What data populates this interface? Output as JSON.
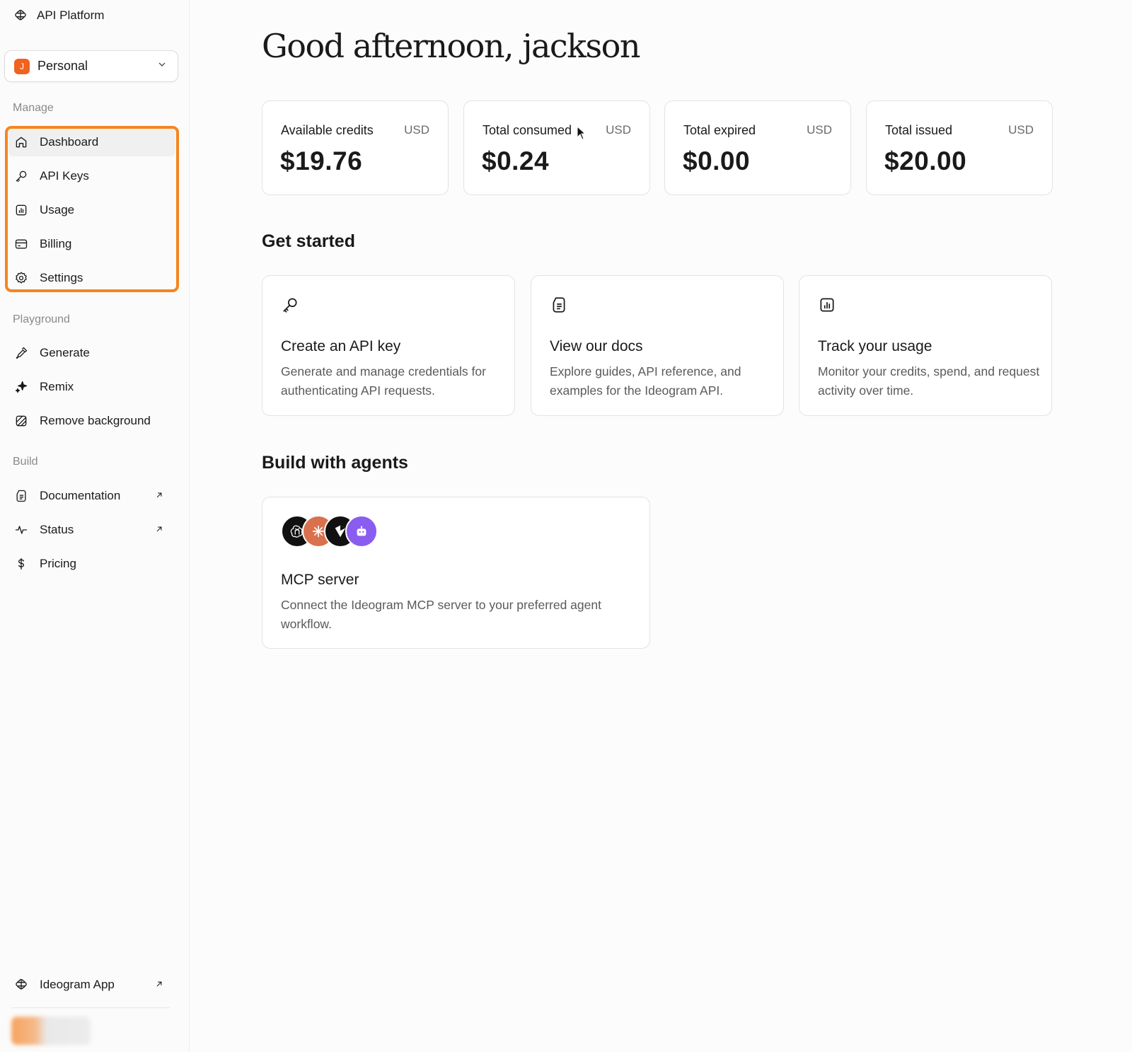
{
  "brand": {
    "name": "API Platform"
  },
  "workspace": {
    "initial": "J",
    "name": "Personal"
  },
  "sidebar": {
    "manage_label": "Manage",
    "manage": [
      {
        "label": "Dashboard",
        "icon": "home-icon"
      },
      {
        "label": "API Keys",
        "icon": "key-icon"
      },
      {
        "label": "Usage",
        "icon": "chart-icon"
      },
      {
        "label": "Billing",
        "icon": "card-icon"
      },
      {
        "label": "Settings",
        "icon": "gear-icon"
      }
    ],
    "playground_label": "Playground",
    "playground": [
      {
        "label": "Generate",
        "icon": "pen-icon"
      },
      {
        "label": "Remix",
        "icon": "sparkle-icon"
      },
      {
        "label": "Remove background",
        "icon": "slash-square-icon"
      }
    ],
    "build_label": "Build",
    "build": [
      {
        "label": "Documentation",
        "icon": "doc-icon",
        "external": true
      },
      {
        "label": "Status",
        "icon": "pulse-icon",
        "external": true
      },
      {
        "label": "Pricing",
        "icon": "dollar-icon"
      }
    ],
    "footer": {
      "label": "Ideogram App",
      "icon": "ideogram-logo-icon",
      "external": true
    }
  },
  "main": {
    "greeting": "Good afternoon, jackson",
    "stats": [
      {
        "label": "Available credits",
        "unit": "USD",
        "value": "$19.76"
      },
      {
        "label": "Total consumed",
        "unit": "USD",
        "value": "$0.24"
      },
      {
        "label": "Total expired",
        "unit": "USD",
        "value": "$0.00"
      },
      {
        "label": "Total issued",
        "unit": "USD",
        "value": "$20.00"
      }
    ],
    "get_started_title": "Get started",
    "get_started": [
      {
        "title": "Create an API key",
        "desc": "Generate and manage credentials for authenticating API requests.",
        "icon": "key-icon"
      },
      {
        "title": "View our docs",
        "desc": "Explore guides, API reference, and examples for the Ideogram API.",
        "icon": "doc-icon"
      },
      {
        "title": "Track your usage",
        "desc": "Monitor your credits, spend, and request activity over time.",
        "icon": "chart-icon"
      }
    ],
    "agents_title": "Build with agents",
    "mcp": {
      "title": "MCP server",
      "desc": "Connect the Ideogram MCP server to your preferred agent workflow.",
      "logos": [
        {
          "name": "openai-logo-icon",
          "color": "#111111"
        },
        {
          "name": "claude-logo-icon",
          "color": "#d9714f"
        },
        {
          "name": "cursor-logo-icon",
          "color": "#111111"
        },
        {
          "name": "bot-logo-icon",
          "color": "#8a5cf0"
        }
      ]
    }
  },
  "colors": {
    "accent": "#f5861f",
    "avatar": "#f0621f"
  }
}
